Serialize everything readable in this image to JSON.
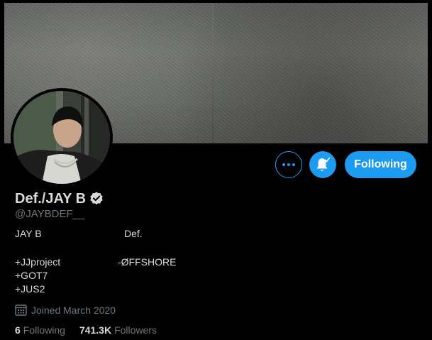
{
  "profile": {
    "display_name": "Def./JAY B",
    "handle": "@JAYBDEF__",
    "verified": true,
    "bio": {
      "line1_left": "JAY B",
      "line1_right": "Def.",
      "line2_left": "+JJproject",
      "line2_right": "-ØFFSHORE",
      "line3": "+GOT7",
      "line4": "+JUS2"
    },
    "joined": "Joined March 2020",
    "following_count": "6",
    "following_label": "Following",
    "followers_count": "741.3K",
    "followers_label": "Followers"
  },
  "actions": {
    "following_button_label": "Following",
    "more_icon": "more-horizontal-icon",
    "bell_icon": "notification-bell-check-icon"
  },
  "icons": {
    "verified": "verified-badge-icon",
    "calendar": "calendar-icon"
  },
  "colors": {
    "accent": "#1d9bf0",
    "background": "#000000",
    "text_primary": "#d9d9d9",
    "text_secondary": "#6e767d"
  }
}
